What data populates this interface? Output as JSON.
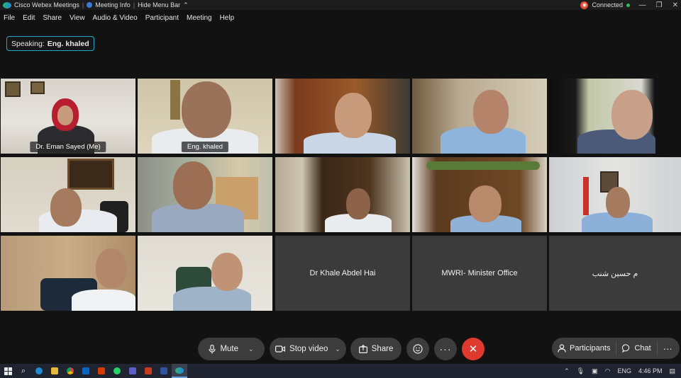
{
  "titlebar": {
    "app_title": "Cisco Webex Meetings",
    "meeting_info": "Meeting Info",
    "hide_menu_bar": "Hide Menu Bar",
    "status": "Connected"
  },
  "menu": [
    "File",
    "Edit",
    "Share",
    "View",
    "Audio & Video",
    "Participant",
    "Meeting",
    "Help"
  ],
  "speaking": {
    "prefix": "Speaking:",
    "name": "Eng. khaled"
  },
  "participants": [
    {
      "name": "Dr. Eman Sayed  (Me)"
    },
    {
      "name": "Eng. khaled"
    },
    {
      "name": "Dr Khale Abdel Hai"
    },
    {
      "name": "MWRI- Minister Office"
    },
    {
      "name": "م حسين شنب"
    }
  ],
  "controls": {
    "mute": "Mute",
    "stop_video": "Stop video",
    "share": "Share",
    "participants": "Participants",
    "chat": "Chat"
  },
  "taskbar": {
    "lang": "ENG",
    "time": "4:46 PM"
  },
  "colors": {
    "accent": "#2aa3c9",
    "leave": "#e0392d",
    "background": "#121212",
    "control": "#3c3c3c"
  }
}
